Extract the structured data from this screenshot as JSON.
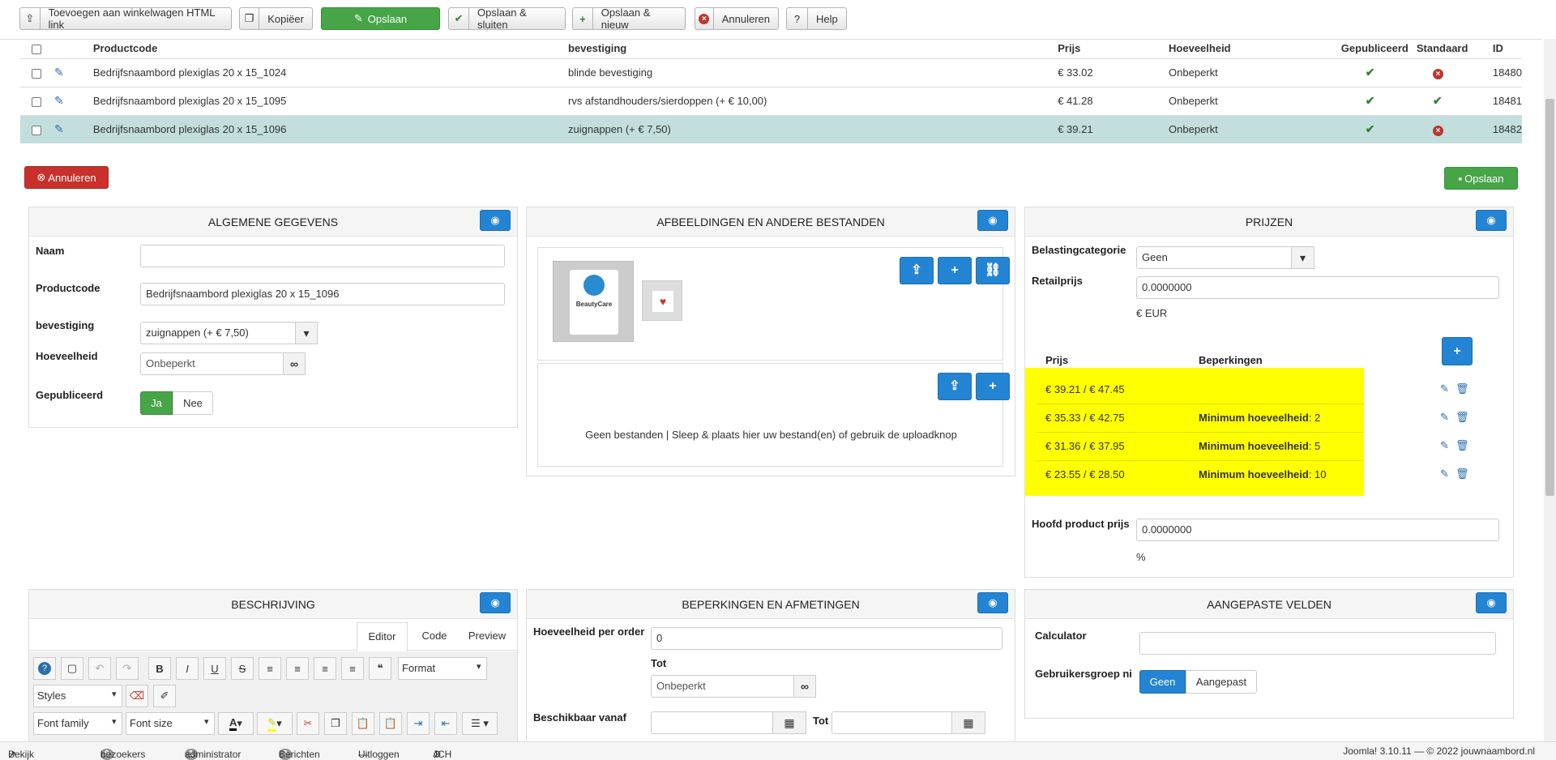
{
  "toolbar": {
    "add_to_cart": "Toevoegen aan winkelwagen HTML link",
    "copy": "Kopiëer",
    "save": "Opslaan",
    "save_close": "Opslaan & sluiten",
    "save_new": "Opslaan & nieuw",
    "cancel": "Annuleren",
    "help": "Help"
  },
  "table": {
    "headers": [
      "Productcode",
      "bevestiging",
      "Prijs",
      "Hoeveelheid",
      "Gepubliceerd",
      "Standaard",
      "ID"
    ],
    "rows": [
      {
        "code": "Bedrijfsnaambord plexiglas 20 x 15_1024",
        "bev": "blinde bevestiging",
        "price": "€ 33.02",
        "qty": "Onbeperkt",
        "id": "18480"
      },
      {
        "code": "Bedrijfsnaambord plexiglas 20 x 15_1095",
        "bev": "rvs afstandhouders/sierdoppen (+ € 10,00)",
        "price": "€ 41.28",
        "qty": "Onbeperkt",
        "id": "18481"
      },
      {
        "code": "Bedrijfsnaambord plexiglas 20 x 15_1096",
        "bev": "zuignappen (+ € 7,50)",
        "price": "€ 39.21",
        "qty": "Onbeperkt",
        "id": "18482"
      }
    ]
  },
  "actions": {
    "cancel": "Annuleren",
    "save": "Opslaan"
  },
  "general": {
    "title": "ALGEMENE GEGEVENS",
    "name_label": "Naam",
    "name_value": "",
    "code_label": "Productcode",
    "code_value": "Bedrijfsnaambord plexiglas 20 x 15_1096",
    "bev_label": "bevestiging",
    "bev_value": "zuignappen (+ € 7,50)",
    "qty_label": "Hoeveelheid",
    "qty_value": "Onbeperkt",
    "pub_label": "Gepubliceerd",
    "yes": "Ja",
    "no": "Nee"
  },
  "images": {
    "title": "AFBEELDINGEN EN ANDERE BESTANDEN",
    "logo_text": "BeautyCare",
    "no_files": "Geen bestanden | Sleep & plaats hier uw bestand(en) of gebruik de uploadknop"
  },
  "prices": {
    "title": "PRIJZEN",
    "tax_label": "Belastingcategorie",
    "tax_value": "Geen",
    "retail_label": "Retailprijs",
    "retail_value": "0.0000000",
    "currency": "€ EUR",
    "col_price": "Prijs",
    "col_limits": "Beperkingen",
    "rows": [
      {
        "price": "€ 39.21 / € 47.45",
        "limit_label": "",
        "limit_value": ""
      },
      {
        "price": "€ 35.33 / € 42.75",
        "limit_label": "Minimum hoeveelheid",
        "limit_value": ": 2"
      },
      {
        "price": "€ 31.36 / € 37.95",
        "limit_label": "Minimum hoeveelheid",
        "limit_value": ": 5"
      },
      {
        "price": "€ 23.55 / € 28.50",
        "limit_label": "Minimum hoeveelheid",
        "limit_value": ": 10"
      }
    ],
    "main_label": "Hoofd product prijs",
    "main_value": "0.0000000",
    "pct": "%"
  },
  "description": {
    "title": "BESCHRIJVING",
    "tabs": [
      "Editor",
      "Code",
      "Preview"
    ],
    "format": "Format",
    "styles": "Styles",
    "font_family": "Font family",
    "font_size": "Font size"
  },
  "limits": {
    "title": "BEPERKINGEN EN AFMETINGEN",
    "per_order_label": "Hoeveelheid per order",
    "per_order_value": "0",
    "tot": "Tot",
    "unlimited": "Onbeperkt",
    "avail_label": "Beschikbaar vanaf",
    "tot2": "Tot"
  },
  "custom": {
    "title": "AANGEPASTE VELDEN",
    "calc_label": "Calculator",
    "group_label": "Gebruikersgroep ni",
    "geen": "Geen",
    "aangepast": "Aangepast"
  },
  "status": {
    "view_site": "Bekijk website",
    "visitors_count": "0",
    "visitors": "bezoekers",
    "admin_count": "1",
    "admin": "administrator",
    "msg_count": "0",
    "messages": "Berichten",
    "logout": "Uitloggen",
    "jch": "JCH Optimize Mode: Production",
    "version": "Joomla! 3.10.11 — © 2022 jouwnaambord.nl"
  }
}
